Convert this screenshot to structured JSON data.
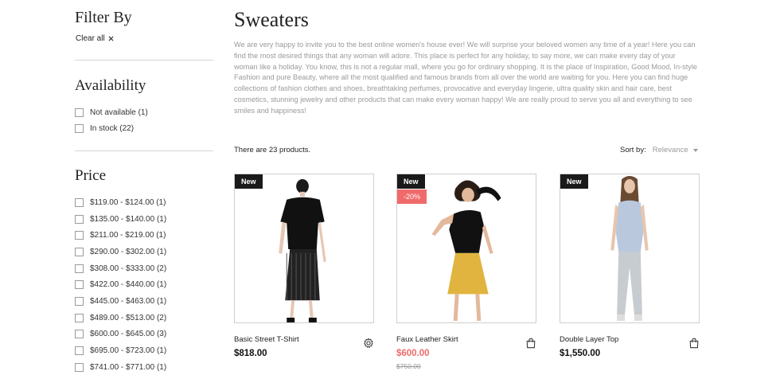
{
  "sidebar": {
    "filter_title": "Filter By",
    "clear_all": "Clear all",
    "availability": {
      "title": "Availability",
      "options": [
        "Not available (1)",
        "In stock (22)"
      ]
    },
    "price": {
      "title": "Price",
      "options": [
        "$119.00 - $124.00 (1)",
        "$135.00 - $140.00 (1)",
        "$211.00 - $219.00 (1)",
        "$290.00 - $302.00 (1)",
        "$308.00 - $333.00 (2)",
        "$422.00 - $440.00 (1)",
        "$445.00 - $463.00 (1)",
        "$489.00 - $513.00 (2)",
        "$600.00 - $645.00 (3)",
        "$695.00 - $723.00 (1)",
        "$741.00 - $771.00 (1)"
      ]
    }
  },
  "main": {
    "title": "Sweaters",
    "description": "We are very happy to invite you to the best online women's house ever! We will surprise your beloved women any time of a year! Here you can find the most desired things that any woman will adore. This place is perfect for any holiday, to say more, we can make every day of your woman like a holiday. You know, this is not a regular mall, where you go for ordinary shopping. It is the place of Inspiration, Good Mood, In-style Fashion and pure Beauty, where all the most qualified and famous brands from all over the world are waiting for you. Here you can find huge collections of fashion clothes and shoes, breathtaking perfumes, provocative and everyday lingerie, ultra quality skin and hair care, best cosmetics, stunning jewelry and other products that can make every woman happy! We are really proud to serve you all and everything to see smiles and happiness!",
    "product_count": "There are 23 products.",
    "sort_label": "Sort by:",
    "sort_value": "Relevance"
  },
  "products": [
    {
      "badge": "New",
      "name": "Basic Street T-Shirt",
      "price": "$818.00",
      "action_icon": "gear-icon"
    },
    {
      "badge": "New",
      "discount": "-20%",
      "name": "Faux Leather Skirt",
      "price": "$600.00",
      "old_price": "$750.00",
      "action_icon": "shopping-bag-icon"
    },
    {
      "badge": "New",
      "name": "Double Layer Top",
      "price": "$1,550.00",
      "action_icon": "shopping-bag-icon"
    }
  ],
  "colors": {
    "accent_sale": "#ef6a6a",
    "badge_dark": "#1a1a1a",
    "muted_text": "#9a9a9a"
  }
}
